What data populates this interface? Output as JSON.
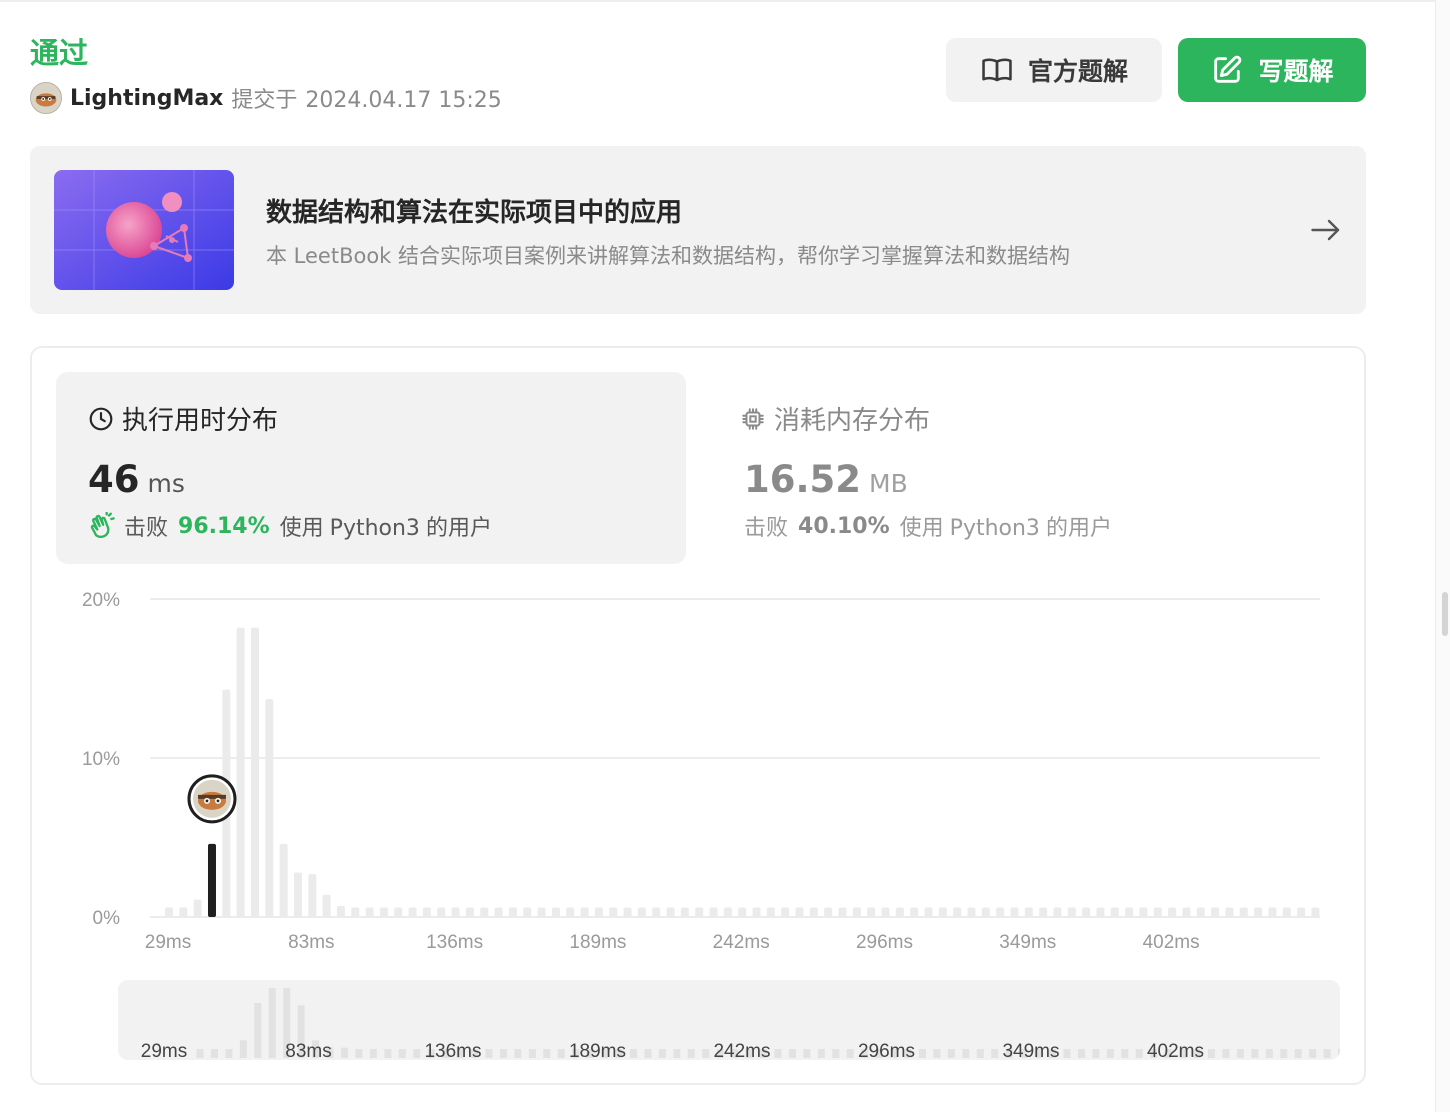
{
  "submission": {
    "status": "通过",
    "username": "LightingMax",
    "submitted_label": "提交于",
    "submitted_at": "2024.04.17 15:25"
  },
  "actions": {
    "official_solution": "官方题解",
    "write_solution": "写题解"
  },
  "book": {
    "title": "数据结构和算法在实际项目中的应用",
    "description": "本 LeetBook 结合实际项目案例来讲解算法和数据结构，帮你学习掌握算法和数据结构"
  },
  "runtime": {
    "title": "执行用时分布",
    "value": "46",
    "unit": "ms",
    "beat_label": "击败",
    "beat_percent": "96.14%",
    "beat_suffix_1": "使用",
    "beat_suffix_2": "Python3",
    "beat_suffix_3": "的用户"
  },
  "memory": {
    "title": "消耗内存分布",
    "value": "16.52",
    "unit": "MB",
    "beat_label": "击败",
    "beat_percent": "40.10%",
    "beat_suffix_1": "使用",
    "beat_suffix_2": "Python3",
    "beat_suffix_3": "的用户"
  },
  "colors": {
    "accent_green": "#2db55d",
    "bar_gray": "#ebebeb",
    "bar_highlight": "#1f1f1f",
    "grid": "#e5e5e5"
  },
  "chart_data": {
    "type": "bar",
    "title": "",
    "xlabel": "",
    "ylabel": "",
    "ylim": [
      0,
      20
    ],
    "y_ticks": [
      "20%",
      "10%",
      "0%"
    ],
    "y_tick_values": [
      20,
      10,
      0
    ],
    "x_tick_labels": [
      "29ms",
      "83ms",
      "136ms",
      "189ms",
      "242ms",
      "296ms",
      "349ms",
      "402ms"
    ],
    "x_tick_bar_index": [
      0,
      10,
      20,
      30,
      40,
      50,
      60,
      70
    ],
    "highlight_index": 3,
    "grid": true,
    "values": [
      0.6,
      0.6,
      1.1,
      4.6,
      14.3,
      18.2,
      18.2,
      13.7,
      4.6,
      2.8,
      2.7,
      1.4,
      0.7,
      0.6,
      0.6,
      0.6,
      0.6,
      0.6,
      0.6,
      0.6,
      0.6,
      0.6,
      0.6,
      0.6,
      0.6,
      0.6,
      0.6,
      0.6,
      0.6,
      0.6,
      0.6,
      0.6,
      0.6,
      0.6,
      0.6,
      0.6,
      0.6,
      0.6,
      0.6,
      0.6,
      0.6,
      0.6,
      0.6,
      0.6,
      0.6,
      0.6,
      0.6,
      0.6,
      0.6,
      0.6,
      0.6,
      0.6,
      0.6,
      0.6,
      0.6,
      0.6,
      0.6,
      0.6,
      0.6,
      0.6,
      0.6,
      0.6,
      0.6,
      0.6,
      0.6,
      0.6,
      0.6,
      0.6,
      0.6,
      0.6,
      0.6,
      0.6,
      0.6,
      0.6,
      0.6,
      0.6,
      0.6,
      0.6,
      0.6,
      0.6,
      0.6
    ]
  }
}
